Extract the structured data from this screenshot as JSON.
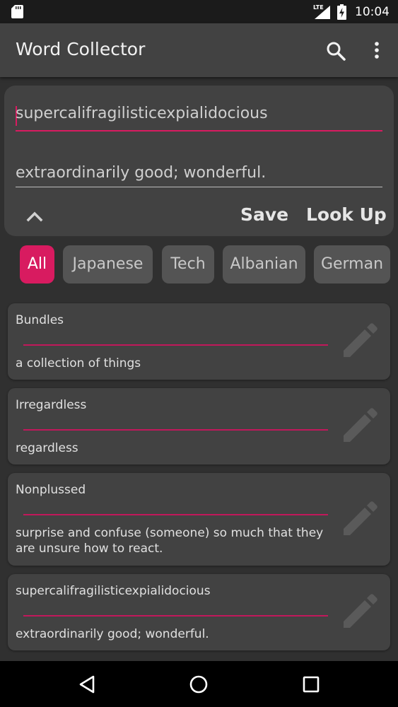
{
  "status_bar": {
    "network": "LTE",
    "time": "10:04"
  },
  "app_bar": {
    "title": "Word Collector"
  },
  "input": {
    "word_value": "supercalifragilisticexpialidocious",
    "definition_value": "extraordinarily good; wonderful.",
    "save_label": "Save",
    "lookup_label": "Look Up"
  },
  "tabs": [
    {
      "label": "All",
      "active": true
    },
    {
      "label": "Japanese"
    },
    {
      "label": "Tech"
    },
    {
      "label": "Albanian"
    },
    {
      "label": "German"
    }
  ],
  "entries": [
    {
      "word": "Bundles",
      "definition": "a collection of things"
    },
    {
      "word": "Irregardless",
      "definition": "regardless"
    },
    {
      "word": "Nonplussed",
      "definition": "surprise and confuse (someone) so much that they are unsure how to react."
    },
    {
      "word": "supercalifragilisticexpialidocious",
      "definition": "extraordinarily good; wonderful."
    }
  ],
  "colors": {
    "accent": "#d81b60",
    "background": "#303030",
    "surface": "#424242",
    "toolbar": "#424242"
  }
}
